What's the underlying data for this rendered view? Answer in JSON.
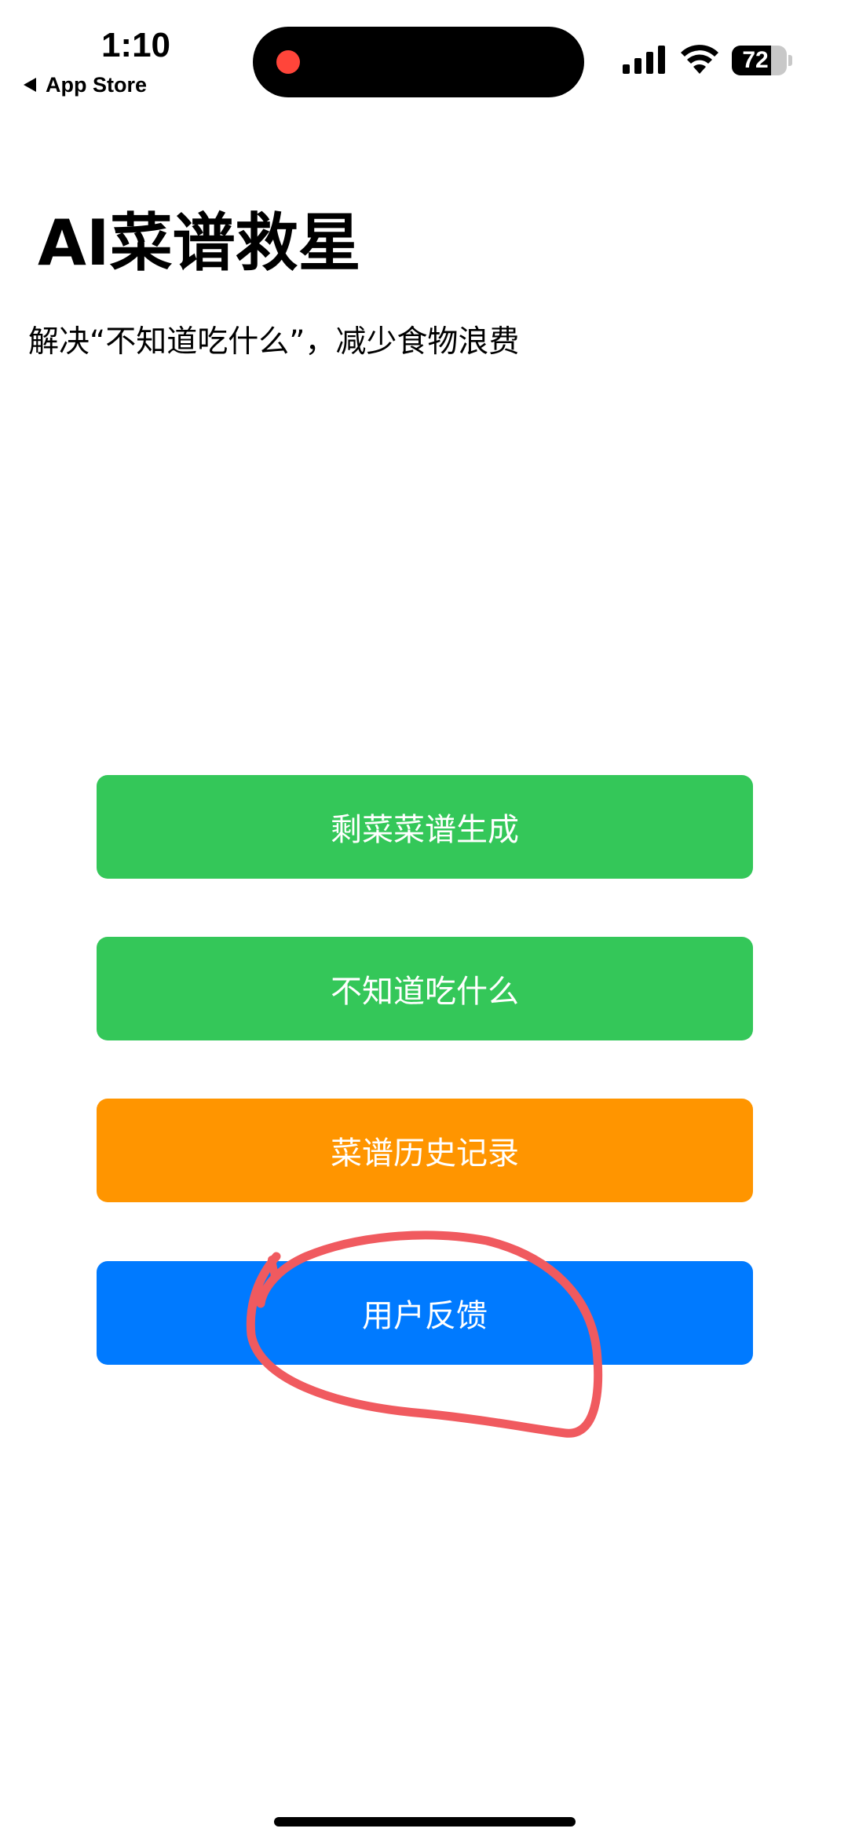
{
  "status_bar": {
    "time": "1:10",
    "back_label": "App Store",
    "battery_text": "72",
    "battery_level": 0.72
  },
  "header": {
    "title": "AI菜谱救星",
    "subtitle": "解决“不知道吃什么”，减少食物浪费"
  },
  "buttons": [
    {
      "label": "剩菜菜谱生成",
      "color": "#34c759"
    },
    {
      "label": "不知道吃什么",
      "color": "#34c759"
    },
    {
      "label": "菜谱历史记录",
      "color": "#ff9500"
    },
    {
      "label": "用户反馈",
      "color": "#007aff"
    }
  ],
  "annotation": {
    "color": "#f05a5f"
  },
  "icons": {
    "status": [
      "signal-icon",
      "wifi-icon",
      "battery-icon"
    ],
    "back": "back-arrow-icon"
  }
}
